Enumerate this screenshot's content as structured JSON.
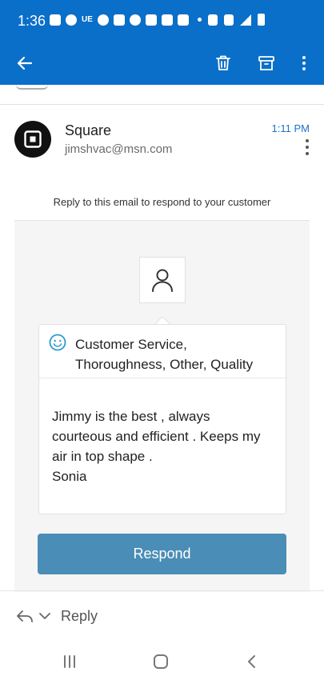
{
  "status_bar": {
    "time": "1:36",
    "carrier_text": "UE"
  },
  "app_bar": {
    "back_icon": "arrow-left-icon",
    "delete_icon": "trash-icon",
    "archive_icon": "archive-icon",
    "more_icon": "more-vertical-icon"
  },
  "email": {
    "sender_name": "Square",
    "sender_email": "jimshvac@msn.com",
    "time": "1:11 PM",
    "reply_hint": "Reply to this email to respond to your customer"
  },
  "feedback": {
    "tags_line1": "Customer Service,",
    "tags_line2": "Thoroughness, Other, Quality",
    "body_lines": [
      "Jimmy is the best , always",
      "courteous and efficient . Keeps my",
      "air in top shape .",
      "Sonia"
    ],
    "respond_label": "Respond"
  },
  "reply_bar": {
    "label": "Reply"
  },
  "colors": {
    "brand_blue": "#0a6fc9",
    "button_blue": "#4a8db6",
    "time_blue": "#1a73c8"
  }
}
